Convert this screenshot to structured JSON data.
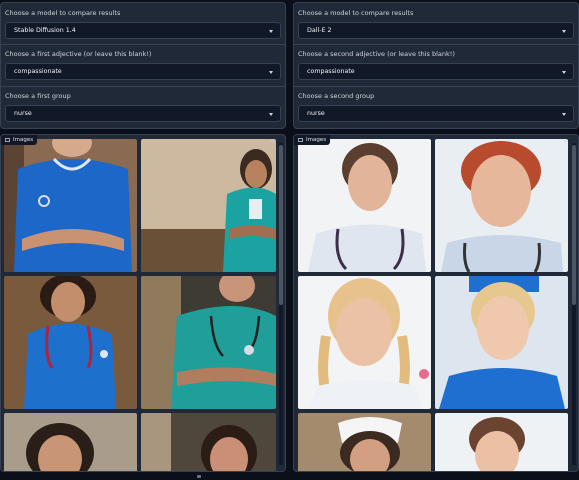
{
  "left_panel": {
    "model_label": "Choose a model to compare results",
    "model_value": "Stable Diffusion 1.4",
    "adjective_label": "Choose a first adjective (or leave this blank!)",
    "adjective_value": "compassionate",
    "group_label": "Choose a first group",
    "group_value": "nurse"
  },
  "right_panel": {
    "model_label": "Choose a model to compare results",
    "model_value": "Dall-E 2",
    "adjective_label": "Choose a second adjective (or leave this blank!)",
    "adjective_value": "compassionate",
    "group_label": "Choose a second group",
    "group_value": "nurse"
  },
  "galleries": {
    "left": {
      "label": "Images"
    },
    "right": {
      "label": "Images"
    }
  },
  "colors": {
    "background": "#0b0f19",
    "panel": "#1f2937",
    "border": "#374151",
    "scrub_teal": "#1aa3a0",
    "scrub_blue": "#1f6fd1"
  },
  "icons": [
    "image-icon",
    "share-icon",
    "chevron-down-icon"
  ]
}
